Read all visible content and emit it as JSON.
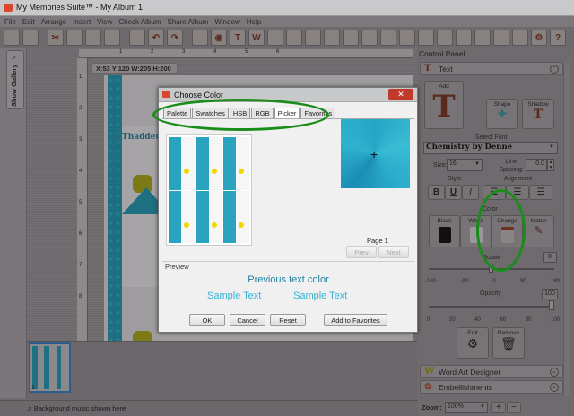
{
  "window": {
    "title": "My Memories Suite™ - My Album 1"
  },
  "menu": [
    "File",
    "Edit",
    "Arrange",
    "Insert",
    "View",
    "Check Album",
    "Share Album",
    "Window",
    "Help"
  ],
  "toolbar": {
    "icons": [
      "album-icon",
      "open-folder-icon",
      "scissors-icon",
      "export-icon",
      "paste-icon",
      "clipboard-icon",
      "ribbon-icon",
      "undo-icon",
      "redo-icon",
      "blank-page-icon",
      "camera-icon",
      "text-icon",
      "word-art-icon",
      "embellishment-icon",
      "shape-icon",
      "photo-icon",
      "frame-icon",
      "mask-icon",
      "sticker-icon",
      "paper-icon",
      "brush-icon",
      "layers-icon",
      "grid-icon",
      "preview-icon",
      "share-icon",
      "color-icon",
      "calendar-icon",
      "settings-icon",
      "help-icon"
    ]
  },
  "gallery": {
    "label": "Show Gallery",
    "chevron": "»"
  },
  "canvas": {
    "coords": "X:53 Y:120  W:205 H:200",
    "ruler_h": [
      "1",
      "2",
      "3",
      "4",
      "5",
      "6"
    ],
    "ruler_v": [
      "1",
      "2",
      "3",
      "4",
      "5",
      "6",
      "7",
      "8"
    ],
    "text_on_page": "Thaddeus"
  },
  "dialog": {
    "title": "Choose Color",
    "close": "✕",
    "tabs": [
      {
        "label": "Palette",
        "active": false
      },
      {
        "label": "Swatches",
        "active": false
      },
      {
        "label": "HSB",
        "active": false
      },
      {
        "label": "RGB",
        "active": false
      },
      {
        "label": "Picker",
        "active": true
      },
      {
        "label": "Favorites",
        "active": false
      }
    ],
    "page_label": "Page 1",
    "prev": "Prev",
    "next": "Next",
    "preview_heading": "Preview",
    "previous_text": "Previous text color",
    "sample1": "Sample Text",
    "sample2": "Sample Text",
    "buttons": {
      "ok": "OK",
      "cancel": "Cancel",
      "reset": "Reset",
      "favorites": "Add to Favorites"
    },
    "picked_color": "#2aaccb"
  },
  "control_panel": {
    "title": "Control Panel",
    "text_section": "Text",
    "add": "Add",
    "shape": "Shape",
    "shadow": "Shadow",
    "select_font_label": "Select Font",
    "font": "Chemistry by Denne",
    "size_label": "Size:",
    "size": "16",
    "line_spacing_label": "Line Spacing:",
    "line_spacing": "0.0",
    "style_label": "Style",
    "alignment_label": "Alignment",
    "style_buttons": [
      "B",
      "U",
      "I"
    ],
    "color_label": "Color",
    "color_buttons": [
      "Black",
      "White",
      "Change",
      "Match"
    ],
    "rotate_label": "Rotate",
    "rotate": "0",
    "rotate_ticks": [
      "-180",
      "-90",
      "0",
      "90",
      "180"
    ],
    "opacity_label": "Opacity",
    "opacity": "100",
    "opacity_ticks": [
      "0",
      "20",
      "40",
      "60",
      "80",
      "100"
    ],
    "edit": "Edit",
    "remove": "Remove",
    "word_art": "Word Art Designer",
    "embellishments": "Embellishments",
    "zoom_label": "Zoom:",
    "zoom": "100%"
  },
  "filmstrip": {
    "page_number": "1",
    "music": "Background music shown here"
  },
  "annotation_color": "#1a8c1a"
}
